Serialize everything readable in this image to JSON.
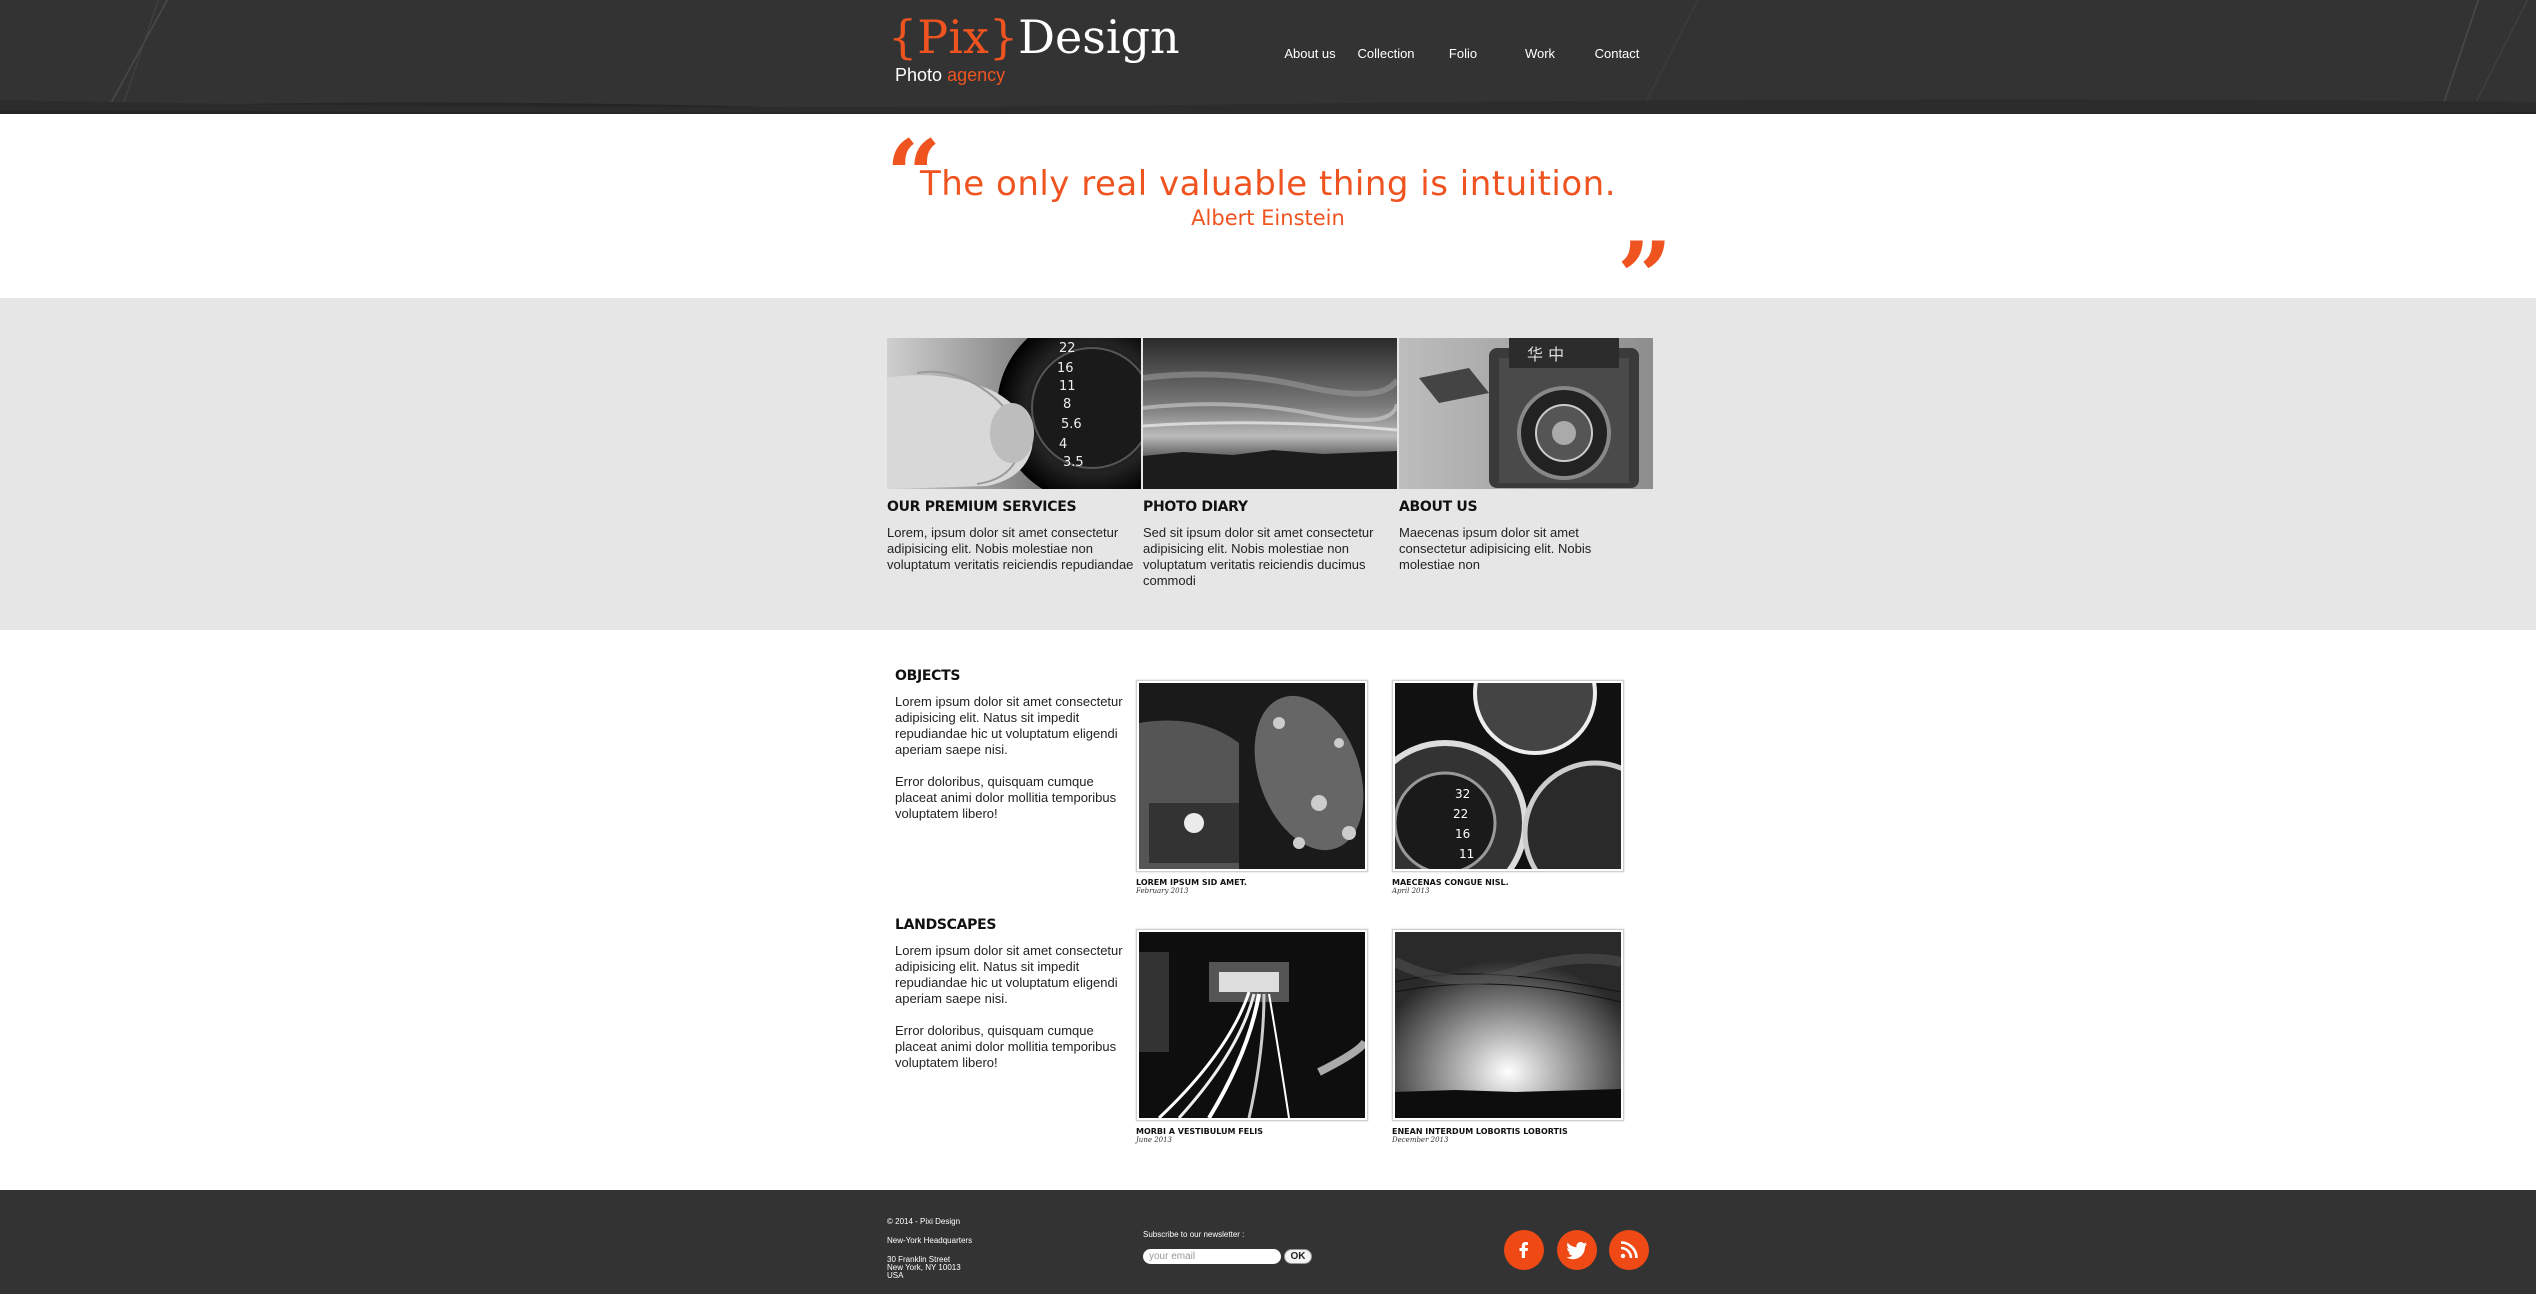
{
  "header": {
    "logo_pix": "{Pix}",
    "logo_design": "Design",
    "logo_photo": "Photo",
    "logo_agency": "agency",
    "nav": [
      "About us",
      "Collection",
      "Folio",
      "Work",
      "Contact"
    ]
  },
  "quote": {
    "text": "The only real valuable thing is intuition.",
    "author": "Albert Einstein"
  },
  "features": [
    {
      "title": "OUR PREMIUM SERVICES",
      "text": "Lorem, ipsum dolor sit amet consectetur adipisicing elit. Nobis molestiae non voluptatum veritatis reiciendis repudiandae",
      "image": "camera-dial-finger"
    },
    {
      "title": "PHOTO DIARY",
      "text": "Sed sit ipsum dolor sit amet consectetur adipisicing elit. Nobis molestiae non voluptatum veritatis reiciendis ducimus commodi",
      "image": "cloudy-sky-sunset"
    },
    {
      "title": "ABOUT US",
      "text": "Maecenas ipsum dolor sit amet consectetur adipisicing elit. Nobis molestiae non",
      "image": "twin-lens-camera"
    }
  ],
  "sections": [
    {
      "title": "OBJECTS",
      "p1": "Lorem ipsum dolor sit amet consectetur adipisicing elit. Natus sit impedit repudiandae hic ut voluptatum eligendi aperiam saepe nisi.",
      "p2": "Error doloribus, quisquam cumque placeat animi dolor mollitia temporibus voluptatem libero!",
      "items": [
        {
          "title": "LOREM IPSUM SID AMET.",
          "date": "February 2013"
        },
        {
          "title": "MAECENAS CONGUE NISL.",
          "date": "April 2013"
        }
      ]
    },
    {
      "title": "LANDSCAPES",
      "p1": "Lorem ipsum dolor sit amet consectetur adipisicing elit. Natus sit impedit repudiandae hic ut voluptatum eligendi aperiam saepe nisi.",
      "p2": "Error doloribus, quisquam cumque placeat animi dolor mollitia temporibus voluptatem libero!",
      "items": [
        {
          "title": "MORBI A VESTIBULUM FELIS",
          "date": "June 2013"
        },
        {
          "title": "ENEAN INTERDUM LOBORTIS LOBORTIS",
          "date": "December 2013"
        }
      ]
    }
  ],
  "footer": {
    "copyright": "© 2014 - Pixi Design",
    "hq": "New-York Headquarters",
    "address1": "30 Franklin Street",
    "address2": "New York, NY 10013",
    "address3": "USA",
    "newsletter_label": "Subscribe to our newsletter :",
    "email_placeholder": "your email",
    "ok_label": "OK",
    "social": [
      "facebook-icon",
      "twitter-icon",
      "rss-icon"
    ]
  },
  "colors": {
    "accent": "#ef5420",
    "dark": "#333333",
    "light_gray": "#e6e6e6"
  }
}
